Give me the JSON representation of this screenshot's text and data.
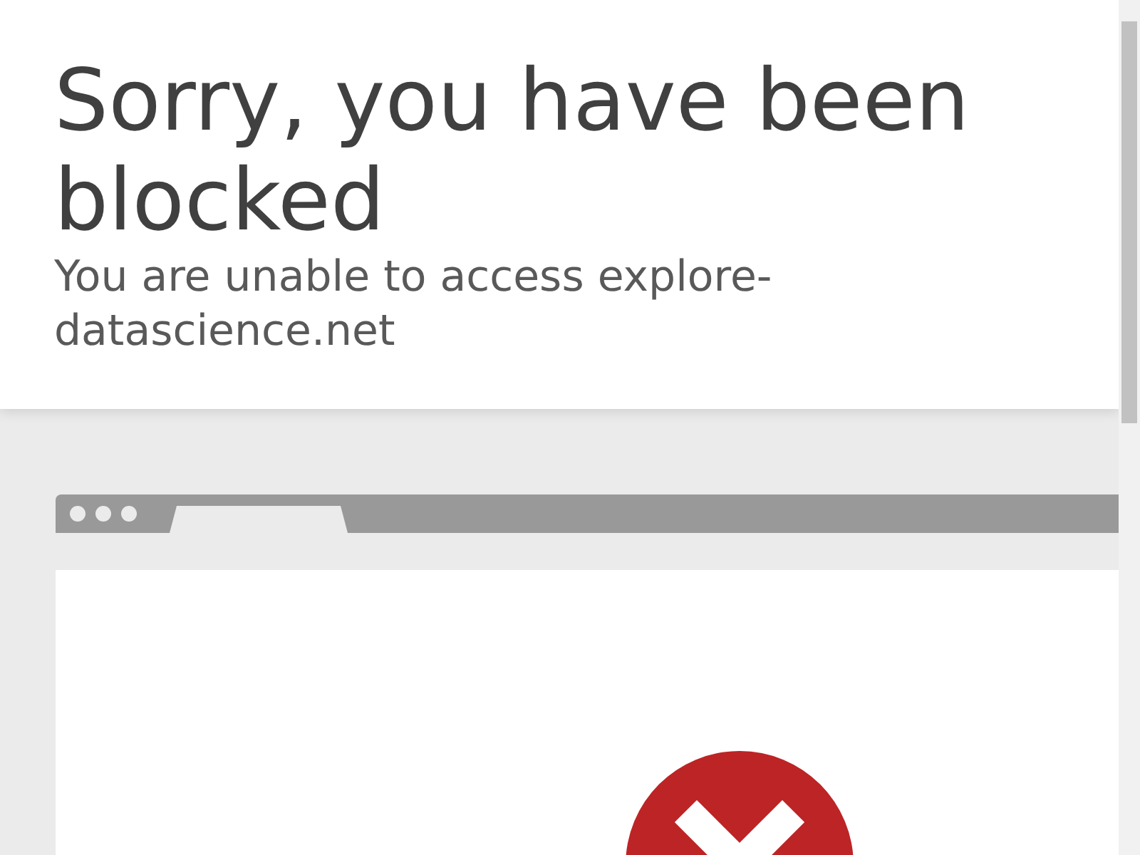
{
  "header": {
    "title": "Sorry, you have been blocked",
    "subtitle": "You are unable to access explore-datascience.net"
  }
}
